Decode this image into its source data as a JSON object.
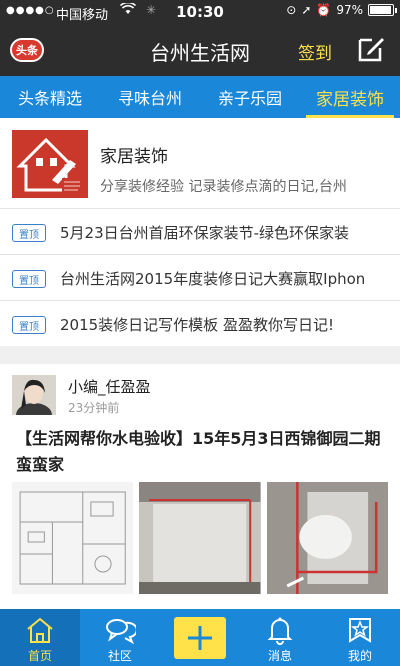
{
  "status_bar": {
    "signal": "●●●●○",
    "carrier": "中国移动",
    "time": "10:30",
    "battery_text": "97%",
    "battery_level": 0.97
  },
  "header": {
    "logo_text": "头条",
    "title": "台州生活网",
    "checkin_label": "签到"
  },
  "tabs": [
    {
      "label": "头条精选",
      "active": false
    },
    {
      "label": "寻味台州",
      "active": false
    },
    {
      "label": "亲子乐园",
      "active": false
    },
    {
      "label": "家居装饰",
      "active": true
    }
  ],
  "channel": {
    "title": "家居装饰",
    "description": "分享装修经验 记录装修点滴的日记,台州"
  },
  "pinned": [
    {
      "badge": "置顶",
      "text": "5月23日台州首届环保家装节-绿色环保家装"
    },
    {
      "badge": "置顶",
      "text": "台州生活网2015年度装修日记大赛赢取Iphon"
    },
    {
      "badge": "置顶",
      "text": "2015装修日记写作模板 盈盈教你写日记!"
    }
  ],
  "post": {
    "author": "小编_任盈盈",
    "time": "23分钟前",
    "title": "【生活网帮你水电验收】15年5月3日西锦御园二期蛮蛮家"
  },
  "bottom_nav": [
    {
      "label": "首页",
      "icon": "home-icon",
      "active": true
    },
    {
      "label": "社区",
      "icon": "chat-bubbles-icon",
      "active": false
    },
    {
      "label": "",
      "icon": "plus-icon",
      "active": false
    },
    {
      "label": "消息",
      "icon": "bell-icon",
      "active": false
    },
    {
      "label": "我的",
      "icon": "profile-star-icon",
      "active": false
    }
  ],
  "colors": {
    "accent_blue": "#1a87d8",
    "highlight_yellow": "#ffe14a",
    "top_bar": "#2d2d2d",
    "logo_red": "#d8392f"
  }
}
